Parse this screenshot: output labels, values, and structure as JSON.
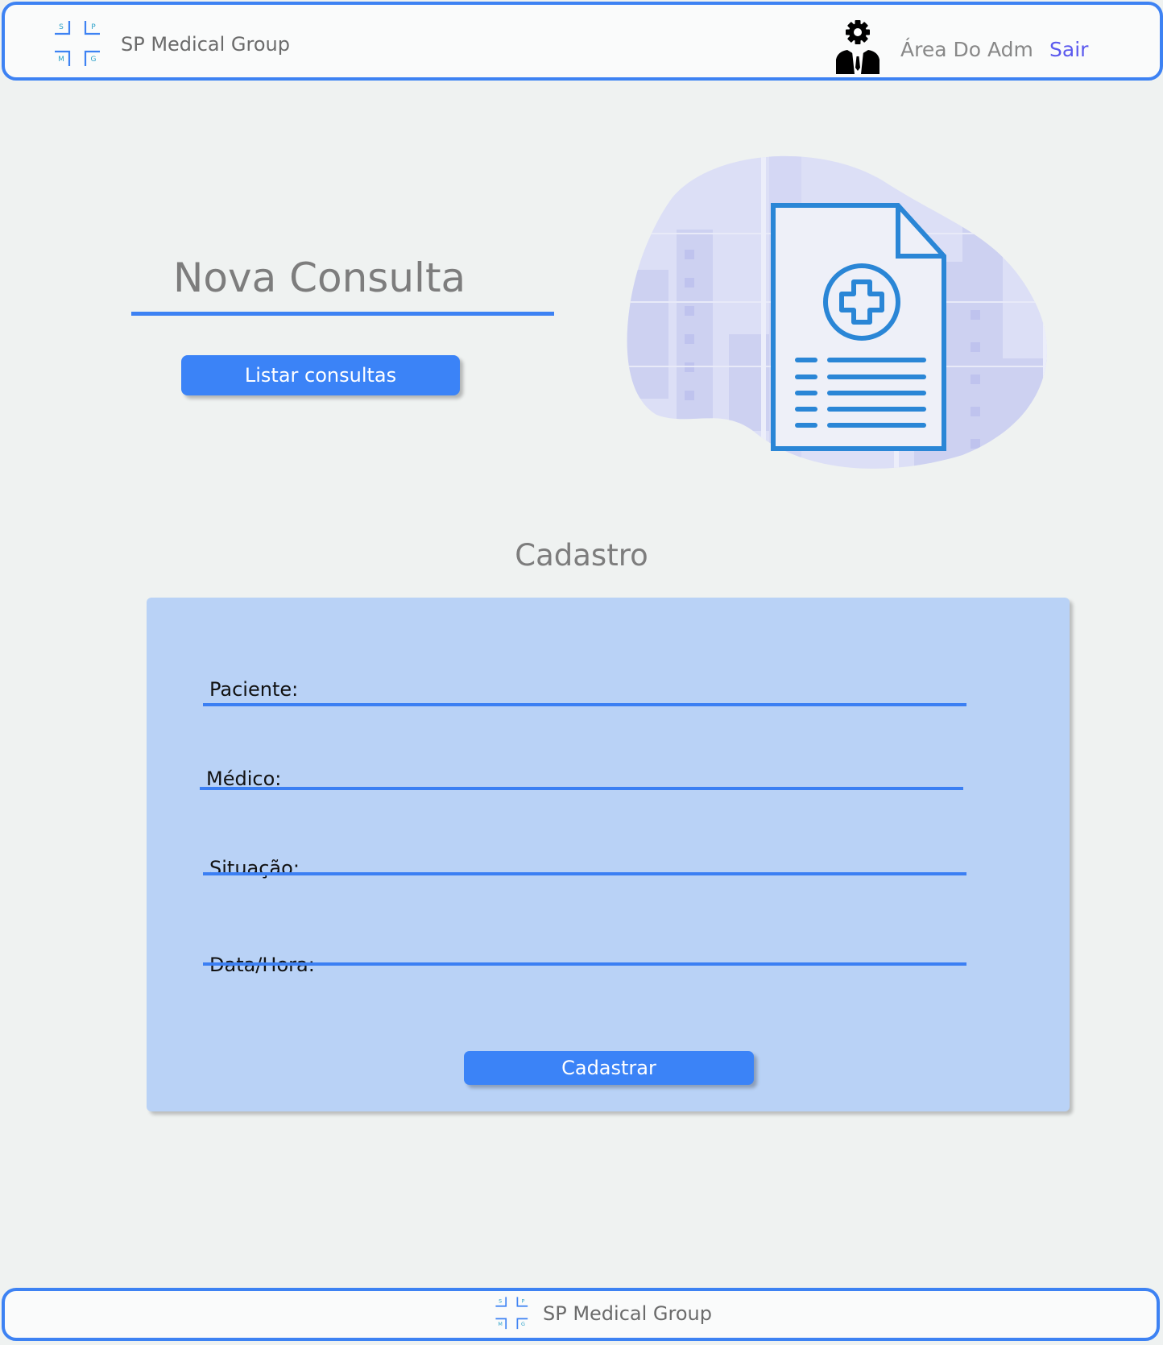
{
  "header": {
    "brand": "SP Medical Group",
    "logo_letters": [
      "S",
      "P",
      "M",
      "G"
    ],
    "admin_label": "Área Do Adm",
    "logout_label": "Sair"
  },
  "hero": {
    "title": "Nova Consulta",
    "list_button": "Listar consultas"
  },
  "form": {
    "section_title": "Cadastro",
    "fields": [
      {
        "label": "Paciente:",
        "value": ""
      },
      {
        "label": "Médico:",
        "value": ""
      },
      {
        "label": "Situação:",
        "value": ""
      },
      {
        "label": "Data/Hora:",
        "value": ""
      }
    ],
    "submit_label": "Cadastrar"
  },
  "footer": {
    "brand": "SP Medical Group"
  },
  "colors": {
    "accent": "#3d82f3",
    "button": "#3b83f7",
    "card": "#b9d2f6",
    "logout": "#5b59ee",
    "background": "#eff2f1"
  },
  "icons": {
    "logo": "spmg-cross-logo-icon",
    "admin": "admin-gear-person-icon",
    "illustration": "medical-document-icon"
  }
}
